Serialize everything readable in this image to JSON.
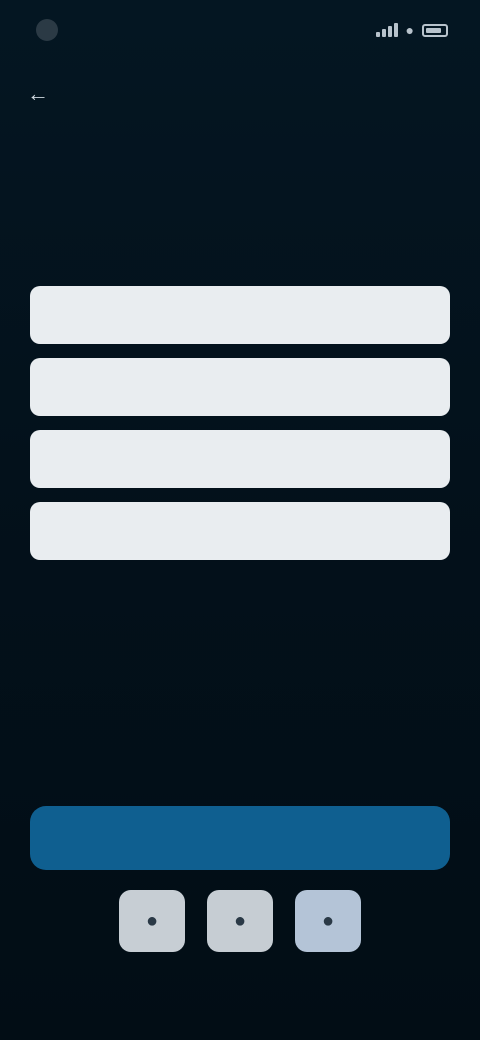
{
  "status_bar": {
    "time": "",
    "icons": [
      "signal-icon",
      "wifi-icon",
      "battery-icon"
    ]
  },
  "header": {
    "back_icon": "arrow-left-icon",
    "title": "",
    "title_accent": "",
    "description": ""
  },
  "form": {
    "section_label": "",
    "fields": [
      {
        "value": ""
      },
      {
        "value": ""
      },
      {
        "value": ""
      },
      {
        "value": ""
      }
    ]
  },
  "helper_text": "",
  "primary_button": {
    "label": ""
  },
  "social_buttons": [
    {
      "icon": "social-icon"
    },
    {
      "icon": "social-icon"
    },
    {
      "icon": "social-icon"
    }
  ],
  "footer_text": "",
  "colors": {
    "background": "#03111b",
    "field": "#e9edf0",
    "primary": "#0f5f90",
    "accent": "#4aa3d8"
  }
}
